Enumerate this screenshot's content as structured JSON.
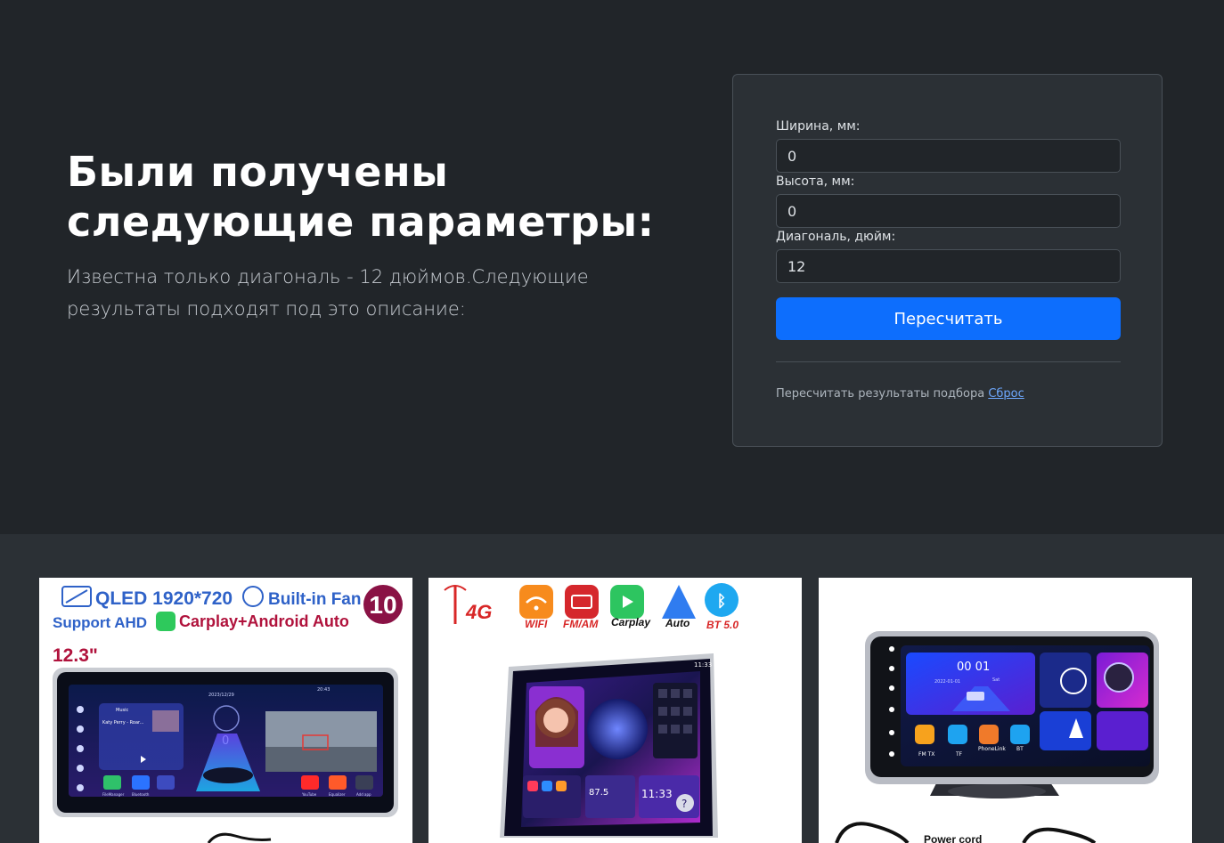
{
  "hero": {
    "title": "Были получены следующие параметры:",
    "description": "Известна только диагональ - 12 дюймов.Следующие результаты подходят под это описание:"
  },
  "form": {
    "width_label": "Ширина, мм:",
    "width_value": "0",
    "height_label": "Высота, мм:",
    "height_value": "0",
    "diagonal_label": "Диагональ, дюйм:",
    "diagonal_value": "12",
    "recalc_button": "Пересчитать",
    "reset_text": "Пересчитать результаты подбора",
    "reset_link": "Сброс"
  },
  "products": [
    {
      "badge_main": "QLED 1920*720",
      "badge_fan": "Built-in Fan",
      "badge_num": "10",
      "badge_ahd": "Support AHD",
      "badge_carplay": "Carplay+Android Auto",
      "size": "12.3\"",
      "screen_date": "2023/12/29",
      "screen_time": "20:43",
      "screen_speed": "0",
      "screen_music": "Music",
      "screen_track": "Katy Perry - Roar...",
      "icon_labels": [
        "FileManager",
        "Bluetooth",
        "",
        "YouTube",
        "Equalizer",
        "Add app"
      ]
    },
    {
      "badge_4g": "4G",
      "features": [
        "WIFI",
        "FM/AM",
        "Carplay",
        "Auto",
        "BT 5.0"
      ],
      "screen_time": "11:33",
      "screen_radio": "87.5",
      "screen_clock": "11:33"
    },
    {
      "screen_time": "00 01",
      "screen_date": "2022-01-01",
      "screen_day": "Sat",
      "icon_labels": [
        "FM TX",
        "TF",
        "PhoneLink",
        "BT"
      ],
      "caption_power": "Power cord"
    }
  ],
  "colors": {
    "page_bg": "#212529",
    "card_bg": "#2b3035",
    "primary": "#0d6efd",
    "link": "#6ea8fe"
  }
}
